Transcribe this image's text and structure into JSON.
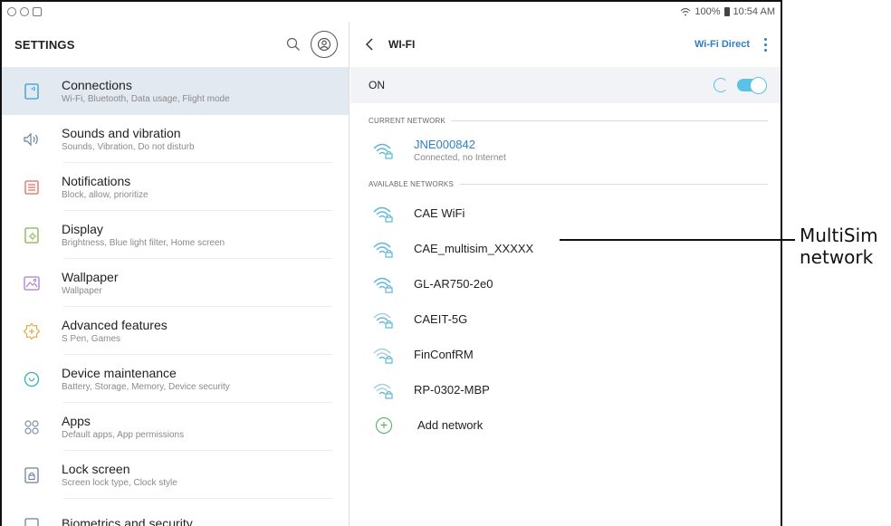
{
  "statusbar": {
    "battery": "100%",
    "time": "10:54 AM"
  },
  "settings": {
    "title": "SETTINGS",
    "items": [
      {
        "icon": "connections-icon",
        "title": "Connections",
        "sub": "Wi-Fi, Bluetooth, Data usage, Flight mode",
        "active": true
      },
      {
        "icon": "sound-icon",
        "title": "Sounds and vibration",
        "sub": "Sounds, Vibration, Do not disturb"
      },
      {
        "icon": "notifications-icon",
        "title": "Notifications",
        "sub": "Block, allow, prioritize"
      },
      {
        "icon": "display-icon",
        "title": "Display",
        "sub": "Brightness, Blue light filter, Home screen"
      },
      {
        "icon": "wallpaper-icon",
        "title": "Wallpaper",
        "sub": "Wallpaper"
      },
      {
        "icon": "advanced-features-icon",
        "title": "Advanced features",
        "sub": "S Pen, Games"
      },
      {
        "icon": "device-maintenance-icon",
        "title": "Device maintenance",
        "sub": "Battery, Storage, Memory, Device security"
      },
      {
        "icon": "apps-icon",
        "title": "Apps",
        "sub": "Default apps, App permissions"
      },
      {
        "icon": "lock-screen-icon",
        "title": "Lock screen",
        "sub": "Screen lock type, Clock style"
      },
      {
        "icon": "biometrics-icon",
        "title": "Biometrics and security",
        "sub": ""
      }
    ]
  },
  "wifi": {
    "title": "WI-FI",
    "direct": "Wi-Fi Direct",
    "on_label": "ON",
    "current_header": "CURRENT NETWORK",
    "current": {
      "name": "JNE000842",
      "status": "Connected, no Internet"
    },
    "available_header": "AVAILABLE NETWORKS",
    "networks": [
      "CAE WiFi",
      "CAE_multisim_XXXXX",
      "GL-AR750-2e0",
      "CAEIT-5G",
      "FinConfRM",
      "RP-0302-MBP"
    ],
    "add_network": "Add network"
  },
  "callout": {
    "line1": "MultiSim",
    "line2": "network"
  },
  "colors": {
    "accent": "#2f7fc1",
    "toggle": "#5bc2e7",
    "active_bg": "#e3e9f1",
    "add": "#4caf50"
  }
}
